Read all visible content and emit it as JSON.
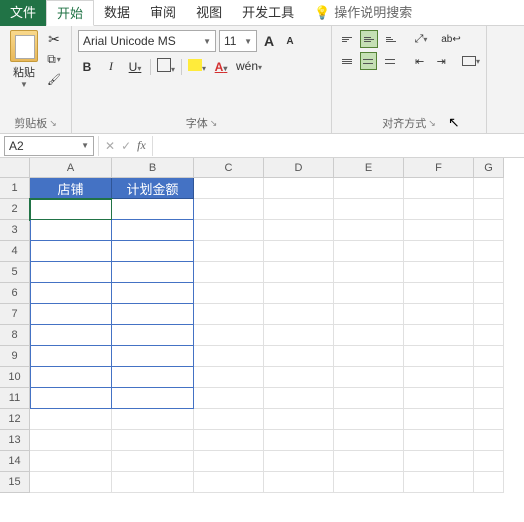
{
  "tabs": {
    "file": "文件",
    "home": "开始",
    "data": "数据",
    "review": "审阅",
    "view": "视图",
    "dev": "开发工具",
    "help": "操作说明搜索"
  },
  "ribbon": {
    "clipboard": {
      "paste": "粘贴",
      "label": "剪贴板"
    },
    "font": {
      "name": "Arial Unicode MS",
      "size": "11",
      "label": "字体",
      "bold": "B",
      "italic": "I",
      "underline": "U",
      "color_letter": "A",
      "wen": "wén"
    },
    "align": {
      "label": "对齐方式",
      "ab": "ab"
    }
  },
  "formula": {
    "name_box": "A2",
    "cancel": "✕",
    "enter": "✓",
    "fx": "fx",
    "value": ""
  },
  "sheet": {
    "cols": [
      "A",
      "B",
      "C",
      "D",
      "E",
      "F",
      "G"
    ],
    "rows": [
      "1",
      "2",
      "3",
      "4",
      "5",
      "6",
      "7",
      "8",
      "9",
      "10",
      "11",
      "12",
      "13",
      "14",
      "15"
    ],
    "headers": {
      "A": "店铺",
      "B": "计划金额"
    },
    "selected": "A2"
  }
}
